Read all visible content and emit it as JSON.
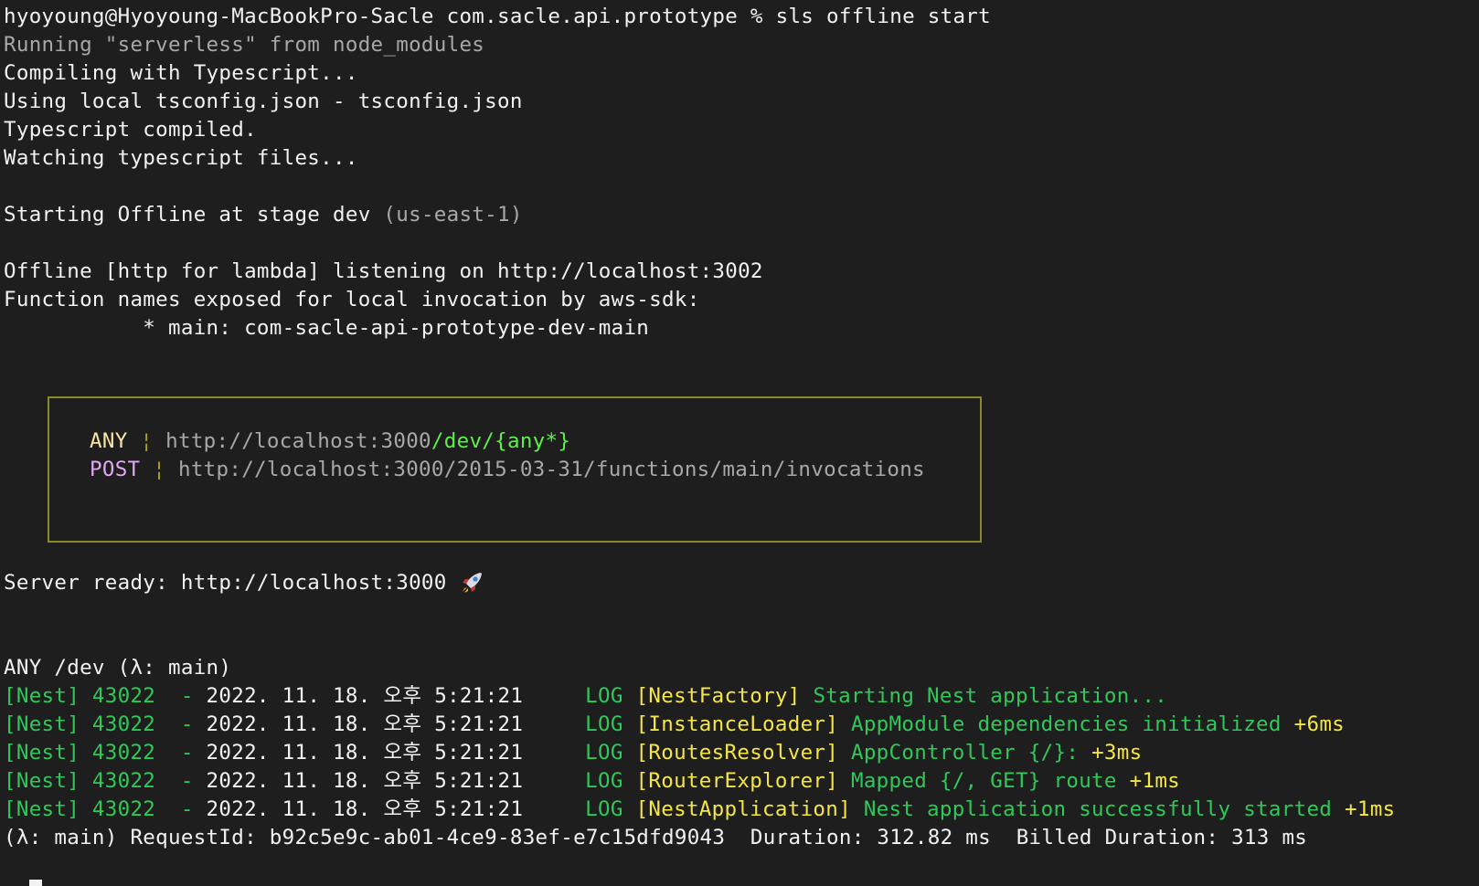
{
  "prompt": {
    "text": "hyoyoung@Hyoyoung-MacBookPro-Sacle com.sacle.api.prototype % sls offline start"
  },
  "output": {
    "running": "Running \"serverless\" from node_modules",
    "compiling": "Compiling with Typescript...",
    "tsconfig": "Using local tsconfig.json - tsconfig.json",
    "compiled": "Typescript compiled.",
    "watching": "Watching typescript files...",
    "starting": "Starting Offline at stage dev",
    "region": "(us-east-1)",
    "offline_http": "Offline [http for lambda] listening on http://localhost:3002",
    "function_names": "Function names exposed for local invocation by aws-sdk:",
    "function_main": "           * main: com-sacle-api-prototype-dev-main"
  },
  "routes": [
    {
      "method": "ANY",
      "sep": "¦",
      "url_base": "http://localhost:3000",
      "url_path": "/dev/{any*}"
    },
    {
      "method": "POST",
      "sep": "¦",
      "url_base": "http://localhost:3000/2015-03-31/functions/main/invocations",
      "url_path": ""
    }
  ],
  "server_ready": {
    "text": "Server ready: http://localhost:3000",
    "icon": "rocket-icon"
  },
  "request": {
    "header": "ANY /dev (λ: main)",
    "logs": [
      {
        "prefix": "[Nest] 43022  - ",
        "timestamp": "2022. 11. 18. 오후 5:21:21",
        "level": "LOG",
        "context": "[NestFactory]",
        "message": "Starting Nest application...",
        "delta": ""
      },
      {
        "prefix": "[Nest] 43022  - ",
        "timestamp": "2022. 11. 18. 오후 5:21:21",
        "level": "LOG",
        "context": "[InstanceLoader]",
        "message": "AppModule dependencies initialized",
        "delta": "+6ms"
      },
      {
        "prefix": "[Nest] 43022  - ",
        "timestamp": "2022. 11. 18. 오후 5:21:21",
        "level": "LOG",
        "context": "[RoutesResolver]",
        "message": "AppController {/}:",
        "delta": "+3ms"
      },
      {
        "prefix": "[Nest] 43022  - ",
        "timestamp": "2022. 11. 18. 오후 5:21:21",
        "level": "LOG",
        "context": "[RouterExplorer]",
        "message": "Mapped {/, GET} route",
        "delta": "+1ms"
      },
      {
        "prefix": "[Nest] 43022  - ",
        "timestamp": "2022. 11. 18. 오후 5:21:21",
        "level": "LOG",
        "context": "[NestApplication]",
        "message": "Nest application successfully started",
        "delta": "+1ms"
      }
    ],
    "summary": "(λ: main) RequestId: b92c5e9c-ab01-4ce9-83ef-e7c15dfd9043  Duration: 312.82 ms  Billed Duration: 313 ms"
  },
  "colors": {
    "background": "#1e1e1e",
    "text": "#f2f2f2",
    "nest_green": "#2fc95a",
    "nest_yellow": "#f5e642",
    "route_box_border": "#8a8a2a",
    "post_purple": "#e2a8f5",
    "path_green": "#5ef04a"
  }
}
